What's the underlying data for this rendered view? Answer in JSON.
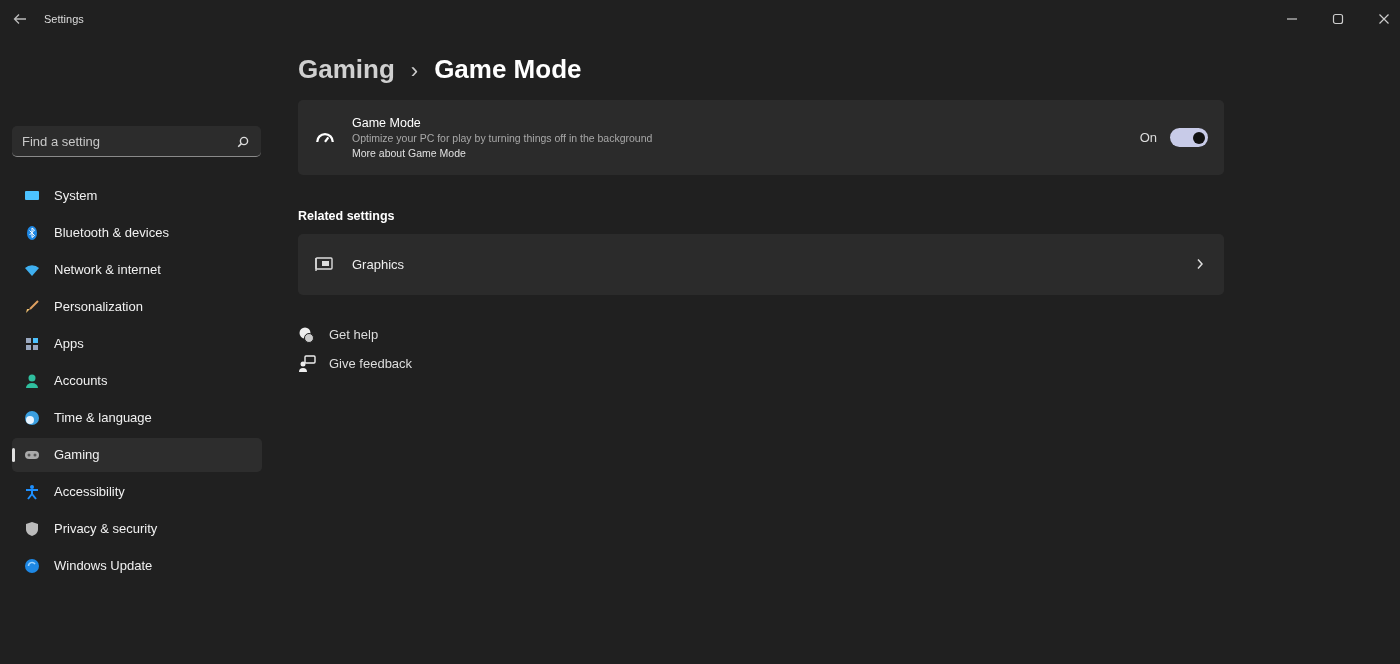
{
  "window": {
    "title": "Settings"
  },
  "search": {
    "placeholder": "Find a setting"
  },
  "nav": [
    {
      "label": "System",
      "selected": false
    },
    {
      "label": "Bluetooth & devices",
      "selected": false
    },
    {
      "label": "Network & internet",
      "selected": false
    },
    {
      "label": "Personalization",
      "selected": false
    },
    {
      "label": "Apps",
      "selected": false
    },
    {
      "label": "Accounts",
      "selected": false
    },
    {
      "label": "Time & language",
      "selected": false
    },
    {
      "label": "Gaming",
      "selected": true
    },
    {
      "label": "Accessibility",
      "selected": false
    },
    {
      "label": "Privacy & security",
      "selected": false
    },
    {
      "label": "Windows Update",
      "selected": false
    }
  ],
  "breadcrumb": {
    "parent": "Gaming",
    "separator": "›",
    "current": "Game Mode"
  },
  "game_mode": {
    "title": "Game Mode",
    "description": "Optimize your PC for play by turning things off in the background",
    "link": "More about Game Mode",
    "state_label": "On",
    "on": true
  },
  "related": {
    "heading": "Related settings",
    "items": [
      {
        "label": "Graphics"
      }
    ]
  },
  "help_links": [
    {
      "label": "Get help"
    },
    {
      "label": "Give feedback"
    }
  ]
}
